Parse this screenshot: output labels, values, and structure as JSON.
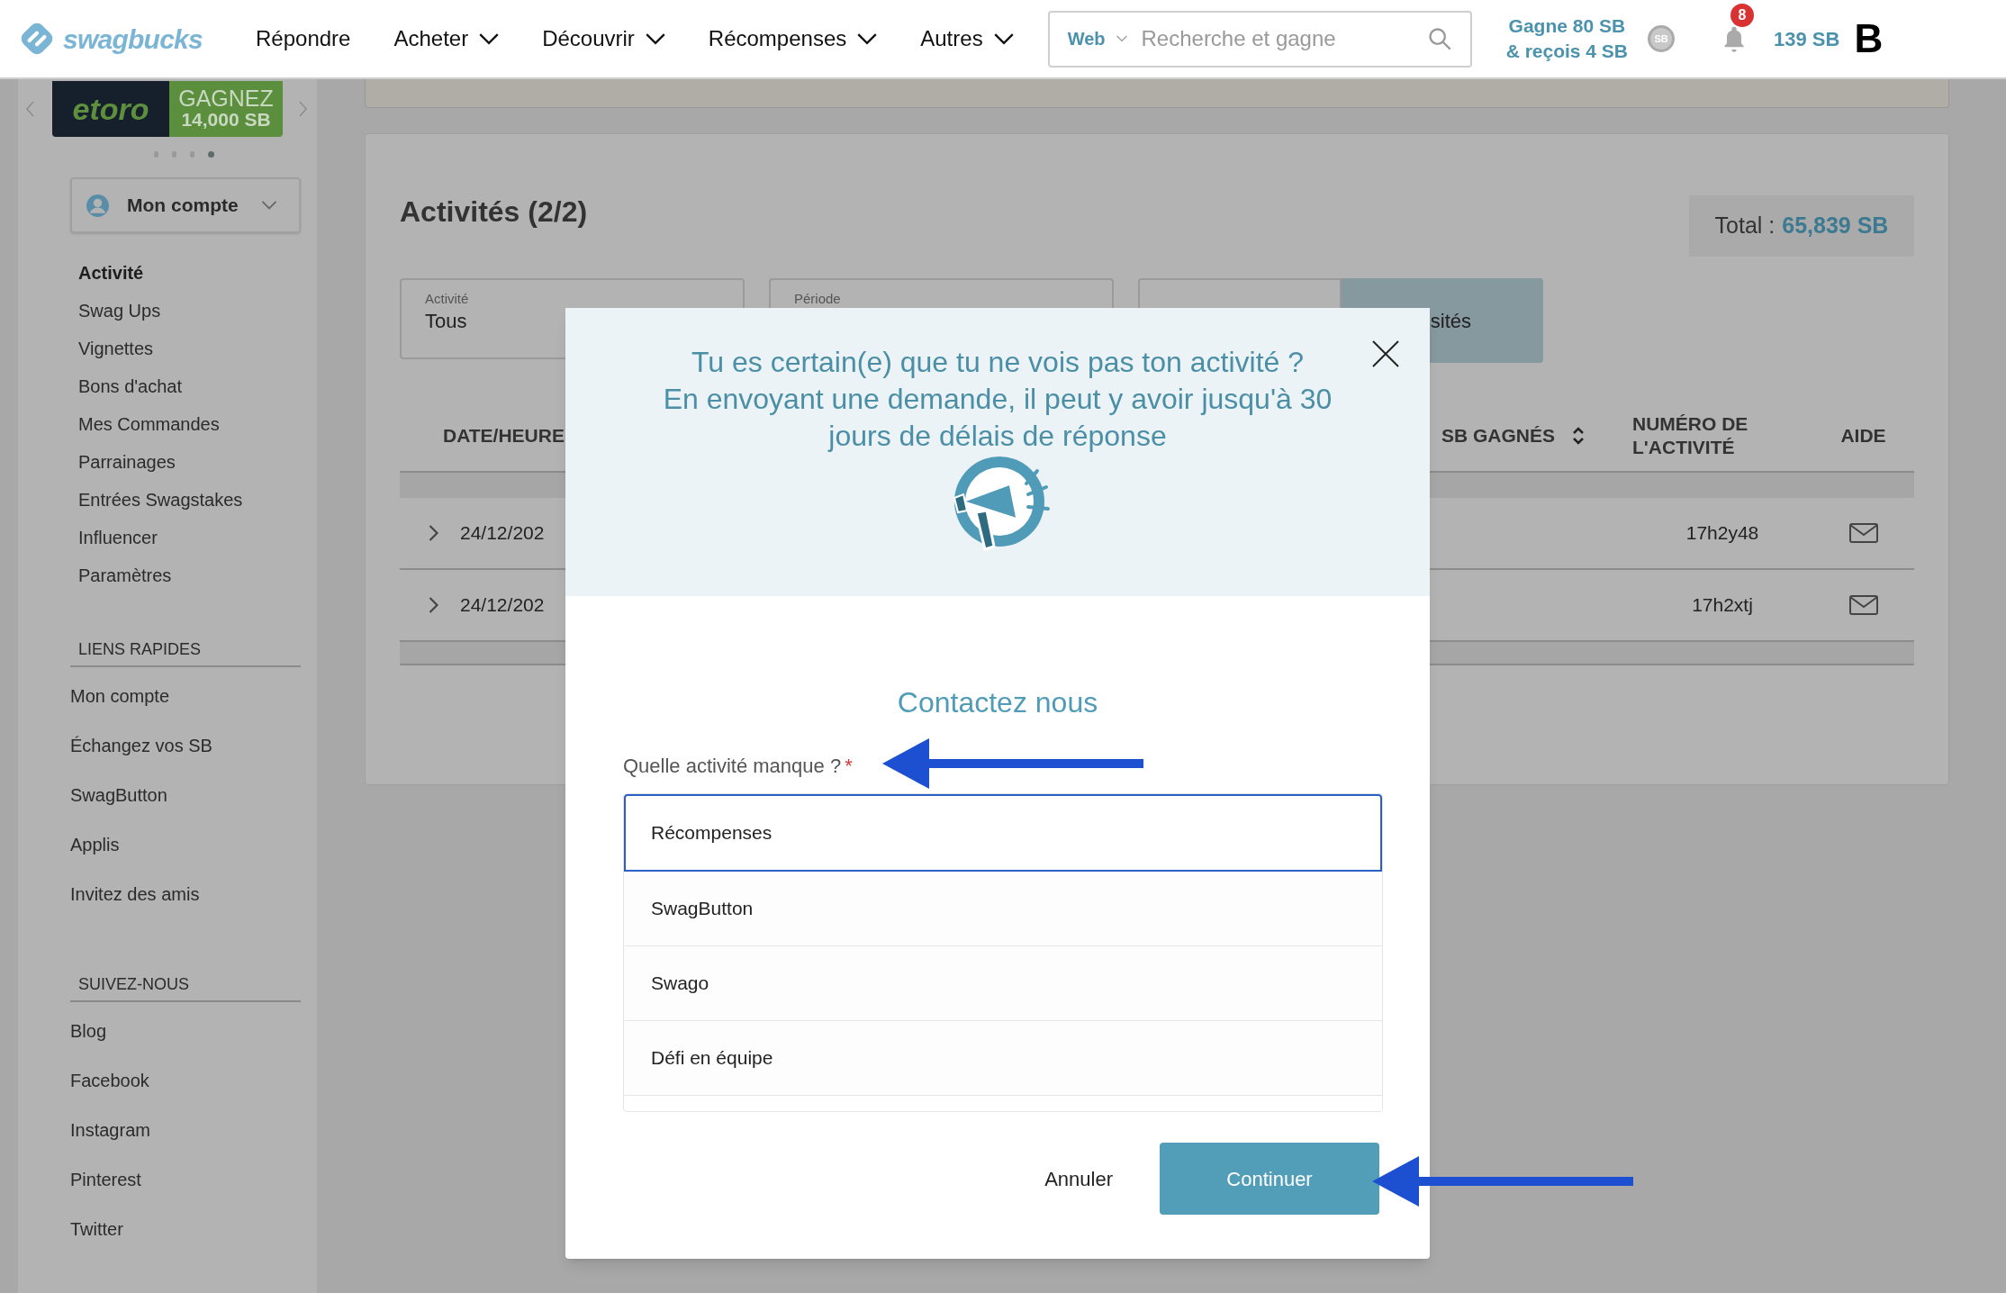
{
  "header": {
    "logo": "swagbucks",
    "nav": [
      {
        "label": "Répondre",
        "dropdown": false
      },
      {
        "label": "Acheter",
        "dropdown": true
      },
      {
        "label": "Découvrir",
        "dropdown": true
      },
      {
        "label": "Récompenses",
        "dropdown": true
      },
      {
        "label": "Autres",
        "dropdown": true
      }
    ],
    "search": {
      "scope": "Web",
      "placeholder": "Recherche et gagne"
    },
    "promo": [
      "Gagne 80 SB",
      "& reçois 4 SB"
    ],
    "coin": "SB",
    "notifications": "8",
    "balance": "139 SB",
    "avatar": "B"
  },
  "sidebar": {
    "banner": {
      "brand": "etoro",
      "headline": "GAGNEZ",
      "amount": "14,000 SB"
    },
    "dots": [
      {
        "selected": false
      },
      {
        "selected": false
      },
      {
        "selected": false
      },
      {
        "selected": true
      }
    ],
    "account_menu": "Mon compte",
    "items": [
      {
        "label": "Activité",
        "selected": true
      },
      {
        "label": "Swag Ups",
        "selected": false
      },
      {
        "label": "Vignettes",
        "selected": false
      },
      {
        "label": "Bons d'achat",
        "selected": false
      },
      {
        "label": "Mes Commandes",
        "selected": false
      },
      {
        "label": "Parrainages",
        "selected": false
      },
      {
        "label": "Entrées Swagstakes",
        "selected": false
      },
      {
        "label": "Influencer",
        "selected": false
      },
      {
        "label": "Paramètres",
        "selected": false
      }
    ],
    "quick_links": {
      "title": "LIENS RAPIDES",
      "items": [
        "Mon compte",
        "Échangez vos SB",
        "SwagButton",
        "Applis",
        "Invitez des amis"
      ]
    },
    "follow": {
      "title": "SUIVEZ-NOUS",
      "items": [
        "Blog",
        "Facebook",
        "Instagram",
        "Pinterest",
        "Twitter"
      ]
    }
  },
  "activity": {
    "title": "Activités (2/2)",
    "total_label": "Total :",
    "total_value": "65,839 SB",
    "filters": [
      {
        "label": "Activité",
        "value": "Tous"
      },
      {
        "label": "Période"
      }
    ],
    "filter_button": "sités",
    "columns": [
      {
        "label": "DATE/HEURE",
        "sortable": false
      },
      {
        "label": "SB GAGNÉS",
        "sortable": true
      },
      {
        "label": "NUMÉRO DE L'ACTIVITÉ",
        "sortable": false
      },
      {
        "label": "AIDE",
        "sortable": false
      }
    ],
    "rows": [
      {
        "date": "24/12/202",
        "number": "17h2y48"
      },
      {
        "date": "24/12/202",
        "number": "17h2xtj"
      }
    ]
  },
  "modal": {
    "title_lines": [
      "Tu es certain(e) que tu ne vois pas ton activité ?",
      "En envoyant une demande, il peut y avoir jusqu'à 30",
      "jours de délais de réponse"
    ],
    "heading": "Contactez nous",
    "field_label": "Quelle activité manque ?",
    "required_mark": "*",
    "options": [
      {
        "label": "Récompenses",
        "selected": true
      },
      {
        "label": "SwagButton",
        "selected": false
      },
      {
        "label": "Swago",
        "selected": false
      },
      {
        "label": "Défi en équipe",
        "selected": false
      }
    ],
    "cancel": "Annuler",
    "continue": "Continuer"
  }
}
